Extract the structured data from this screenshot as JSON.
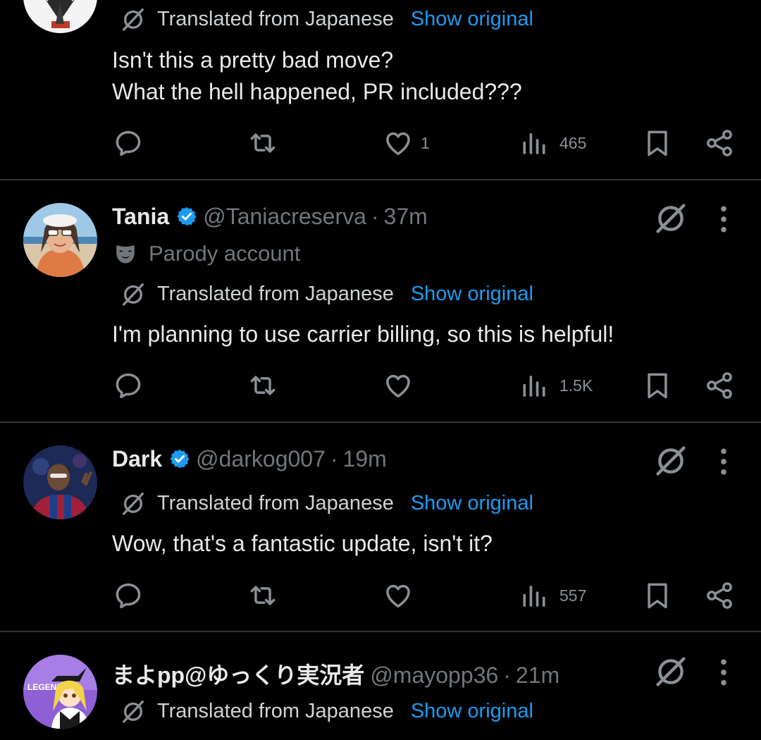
{
  "posts": [
    {
      "translated_label": "Translated from Japanese",
      "show_original": "Show original",
      "lines": [
        "Isn't this a pretty bad move?",
        "What the hell happened, PR included???"
      ],
      "likes": "1",
      "views": "465"
    },
    {
      "name": "Tania",
      "handle": "@Taniacreserva",
      "separator": "·",
      "time": "37m",
      "parody": "Parody account",
      "translated_label": "Translated from Japanese",
      "show_original": "Show original",
      "lines": [
        "I'm planning to use carrier billing, so this is helpful!"
      ],
      "views": "1.5K"
    },
    {
      "name": "Dark",
      "handle": "@darkog007",
      "separator": "·",
      "time": "19m",
      "translated_label": "Translated from Japanese",
      "show_original": "Show original",
      "lines": [
        "Wow, that's a fantastic update, isn't it?"
      ],
      "views": "557"
    },
    {
      "name": "まよpp@ゆっくり実況者",
      "handle": "@mayopp36",
      "separator": "·",
      "time": "21m",
      "avatar_text": "LEGEND",
      "translated_label": "Translated from Japanese",
      "show_original": "Show original"
    }
  ],
  "icons": {
    "reply": "reply-icon",
    "repost": "repost-icon",
    "like": "heart-icon",
    "views": "views-icon",
    "bookmark": "bookmark-icon",
    "share": "share-icon",
    "grok": "grok-icon",
    "more": "more-icon",
    "verified": "verified-badge-icon",
    "translate": "translate-icon",
    "parody": "parody-mask-icon"
  },
  "colors": {
    "background": "#000000",
    "text": "#e7e9ea",
    "muted": "#71767b",
    "link": "#1d9bf0",
    "divider": "#2f3336",
    "verified": "#1d9bf0"
  }
}
